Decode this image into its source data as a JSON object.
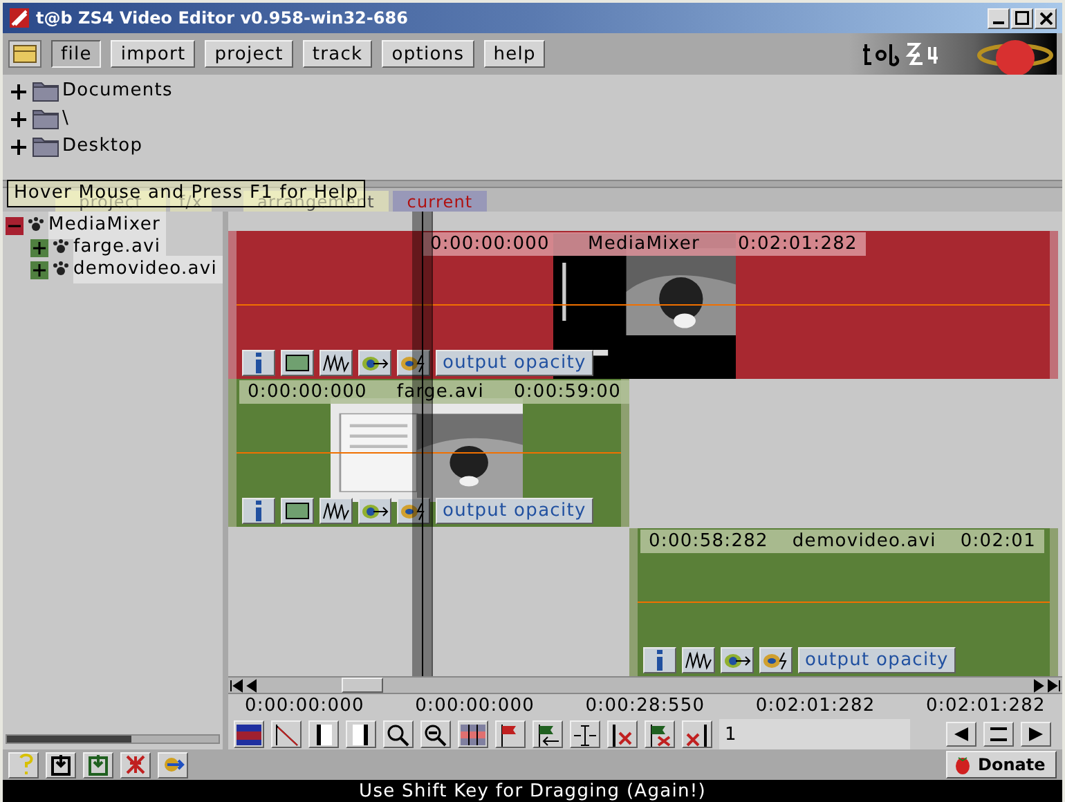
{
  "window": {
    "title": "t@b ZS4 Video Editor v0.958-win32-686"
  },
  "menu": [
    {
      "label": "file",
      "selected": true
    },
    {
      "label": "import",
      "selected": false
    },
    {
      "label": "project",
      "selected": false
    },
    {
      "label": "track",
      "selected": false
    },
    {
      "label": "options",
      "selected": false
    },
    {
      "label": "help",
      "selected": false
    }
  ],
  "file_tree": [
    {
      "label": "Documents",
      "expanded": false
    },
    {
      "label": "\\",
      "expanded": false
    },
    {
      "label": "Desktop",
      "expanded": false
    }
  ],
  "tabs": [
    {
      "label": "project",
      "selected": false
    },
    {
      "label": "f/x",
      "selected": false
    },
    {
      "label": "arrangement",
      "selected": false
    },
    {
      "label": "current",
      "selected": true
    }
  ],
  "tooltip": "Hover Mouse and Press F1 for Help",
  "project_tree": [
    {
      "label": "MediaMixer",
      "expanded": true,
      "children": [
        {
          "label": "farge.avi",
          "expanded": false
        },
        {
          "label": "demovideo.avi",
          "expanded": false
        }
      ]
    }
  ],
  "clips": [
    {
      "kind": "mixer",
      "start": "0:00:00:000",
      "name": "MediaMixer",
      "end": "0:02:01:282",
      "tools": [
        {
          "kind": "info"
        },
        {
          "kind": "frame"
        },
        {
          "kind": "wave"
        },
        {
          "kind": "link"
        },
        {
          "kind": "fade"
        }
      ],
      "control": "output opacity"
    },
    {
      "kind": "video",
      "start": "0:00:00:000",
      "name": "farge.avi",
      "end": "0:00:59:00",
      "tools": [
        {
          "kind": "info"
        },
        {
          "kind": "frame"
        },
        {
          "kind": "wave"
        },
        {
          "kind": "link"
        },
        {
          "kind": "fade"
        }
      ],
      "control": "output opacity"
    },
    {
      "kind": "video",
      "start": "0:00:58:282",
      "name": "demovideo.avi",
      "end": "0:02:01",
      "tools": [
        {
          "kind": "info"
        },
        {
          "kind": "wave"
        },
        {
          "kind": "link"
        },
        {
          "kind": "fade"
        }
      ],
      "control": "output opacity"
    }
  ],
  "time_labels": [
    "0:00:00:000",
    "0:00:00:000",
    "0:00:28:550",
    "0:02:01:282",
    "0:02:01:282"
  ],
  "toolbar_field": {
    "value": "1"
  },
  "donate_button": "Donate",
  "status_bar": "Use Shift Key for Dragging (Again!)"
}
